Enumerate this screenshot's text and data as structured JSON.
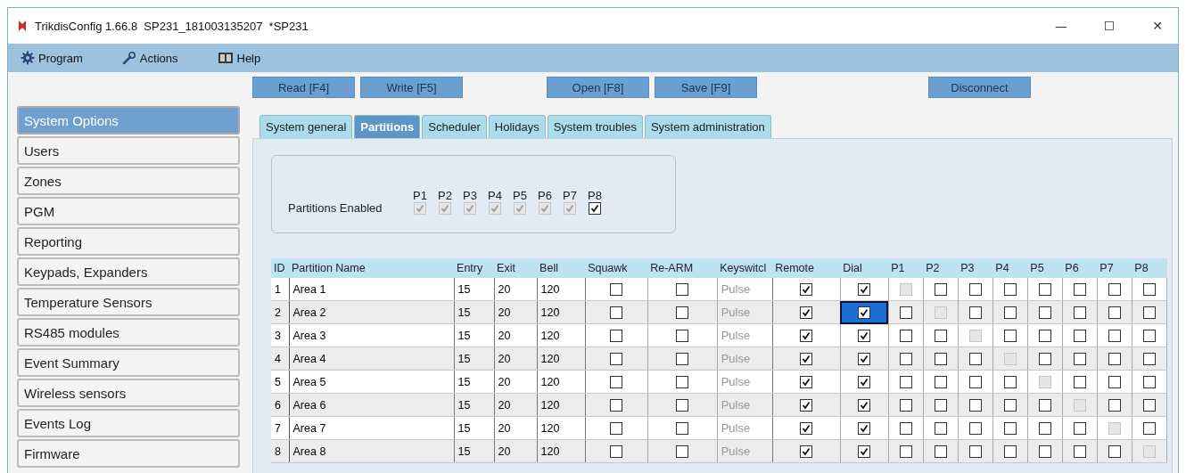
{
  "window": {
    "title": "TrikdisConfig 1.66.8  SP231_181003135207  *SP231",
    "controls": [
      "—",
      "☐",
      "✕"
    ]
  },
  "menu": [
    {
      "label": "Program"
    },
    {
      "label": "Actions"
    },
    {
      "label": "Help"
    }
  ],
  "toolbar": [
    {
      "label": "Read [F4]"
    },
    {
      "label": "Write [F5]"
    },
    {
      "label": "Open [F8]"
    },
    {
      "label": "Save [F9]"
    },
    {
      "label": "Disconnect"
    }
  ],
  "sidebar": {
    "items": [
      {
        "label": "System Options",
        "selected": true
      },
      {
        "label": "Users",
        "selected": false
      },
      {
        "label": "Zones",
        "selected": false
      },
      {
        "label": "PGM",
        "selected": false
      },
      {
        "label": "Reporting",
        "selected": false
      },
      {
        "label": "Keypads, Expanders",
        "selected": false
      },
      {
        "label": "Temperature Sensors",
        "selected": false
      },
      {
        "label": "RS485 modules",
        "selected": false
      },
      {
        "label": "Event Summary",
        "selected": false
      },
      {
        "label": "Wireless sensors",
        "selected": false
      },
      {
        "label": "Events Log",
        "selected": false
      },
      {
        "label": "Firmware",
        "selected": false
      }
    ]
  },
  "tabs": [
    {
      "label": "System general",
      "selected": false
    },
    {
      "label": "Partitions",
      "selected": true
    },
    {
      "label": "Scheduler",
      "selected": false
    },
    {
      "label": "Holidays",
      "selected": false
    },
    {
      "label": "System troubles",
      "selected": false
    },
    {
      "label": "System administration",
      "selected": false
    }
  ],
  "partitions_enabled": {
    "label": "Partitions Enabled",
    "items": [
      {
        "label": "P1",
        "checked": true,
        "disabled": true
      },
      {
        "label": "P2",
        "checked": true,
        "disabled": true
      },
      {
        "label": "P3",
        "checked": true,
        "disabled": true
      },
      {
        "label": "P4",
        "checked": true,
        "disabled": true
      },
      {
        "label": "P5",
        "checked": true,
        "disabled": true
      },
      {
        "label": "P6",
        "checked": true,
        "disabled": true
      },
      {
        "label": "P7",
        "checked": true,
        "disabled": true
      },
      {
        "label": "P8",
        "checked": true,
        "disabled": false
      }
    ]
  },
  "table": {
    "columns": [
      "ID",
      "Partition Name",
      "Entry",
      "Exit",
      "Bell",
      "Squawk",
      "Re-ARM",
      "Keyswitcl",
      "Remote",
      "Dial",
      "P1",
      "P2",
      "P3",
      "P4",
      "P5",
      "P6",
      "P7",
      "P8"
    ],
    "rows": [
      {
        "id": "1",
        "name": "Area 1",
        "entry": "15",
        "exit": "20",
        "bell": "120",
        "squawk": false,
        "rearm": false,
        "keyswitch": "Pulse",
        "remote": true,
        "dial": true,
        "dial_selected": false,
        "partitions": [
          {
            "checked": false,
            "disabled": true
          },
          {
            "checked": false,
            "disabled": false
          },
          {
            "checked": false,
            "disabled": false
          },
          {
            "checked": false,
            "disabled": false
          },
          {
            "checked": false,
            "disabled": false
          },
          {
            "checked": false,
            "disabled": false
          },
          {
            "checked": false,
            "disabled": false
          },
          {
            "checked": false,
            "disabled": false
          }
        ]
      },
      {
        "id": "2",
        "name": "Area 2",
        "entry": "15",
        "exit": "20",
        "bell": "120",
        "squawk": false,
        "rearm": false,
        "keyswitch": "Pulse",
        "remote": true,
        "dial": true,
        "dial_selected": true,
        "partitions": [
          {
            "checked": false,
            "disabled": false
          },
          {
            "checked": false,
            "disabled": true
          },
          {
            "checked": false,
            "disabled": false
          },
          {
            "checked": false,
            "disabled": false
          },
          {
            "checked": false,
            "disabled": false
          },
          {
            "checked": false,
            "disabled": false
          },
          {
            "checked": false,
            "disabled": false
          },
          {
            "checked": false,
            "disabled": false
          }
        ]
      },
      {
        "id": "3",
        "name": "Area 3",
        "entry": "15",
        "exit": "20",
        "bell": "120",
        "squawk": false,
        "rearm": false,
        "keyswitch": "Pulse",
        "remote": true,
        "dial": true,
        "dial_selected": false,
        "partitions": [
          {
            "checked": false,
            "disabled": false
          },
          {
            "checked": false,
            "disabled": false
          },
          {
            "checked": false,
            "disabled": true
          },
          {
            "checked": false,
            "disabled": false
          },
          {
            "checked": false,
            "disabled": false
          },
          {
            "checked": false,
            "disabled": false
          },
          {
            "checked": false,
            "disabled": false
          },
          {
            "checked": false,
            "disabled": false
          }
        ]
      },
      {
        "id": "4",
        "name": "Area 4",
        "entry": "15",
        "exit": "20",
        "bell": "120",
        "squawk": false,
        "rearm": false,
        "keyswitch": "Pulse",
        "remote": true,
        "dial": true,
        "dial_selected": false,
        "partitions": [
          {
            "checked": false,
            "disabled": false
          },
          {
            "checked": false,
            "disabled": false
          },
          {
            "checked": false,
            "disabled": false
          },
          {
            "checked": false,
            "disabled": true
          },
          {
            "checked": false,
            "disabled": false
          },
          {
            "checked": false,
            "disabled": false
          },
          {
            "checked": false,
            "disabled": false
          },
          {
            "checked": false,
            "disabled": false
          }
        ]
      },
      {
        "id": "5",
        "name": "Area 5",
        "entry": "15",
        "exit": "20",
        "bell": "120",
        "squawk": false,
        "rearm": false,
        "keyswitch": "Pulse",
        "remote": true,
        "dial": true,
        "dial_selected": false,
        "partitions": [
          {
            "checked": false,
            "disabled": false
          },
          {
            "checked": false,
            "disabled": false
          },
          {
            "checked": false,
            "disabled": false
          },
          {
            "checked": false,
            "disabled": false
          },
          {
            "checked": false,
            "disabled": true
          },
          {
            "checked": false,
            "disabled": false
          },
          {
            "checked": false,
            "disabled": false
          },
          {
            "checked": false,
            "disabled": false
          }
        ]
      },
      {
        "id": "6",
        "name": "Area 6",
        "entry": "15",
        "exit": "20",
        "bell": "120",
        "squawk": false,
        "rearm": false,
        "keyswitch": "Pulse",
        "remote": true,
        "dial": true,
        "dial_selected": false,
        "partitions": [
          {
            "checked": false,
            "disabled": false
          },
          {
            "checked": false,
            "disabled": false
          },
          {
            "checked": false,
            "disabled": false
          },
          {
            "checked": false,
            "disabled": false
          },
          {
            "checked": false,
            "disabled": false
          },
          {
            "checked": false,
            "disabled": true
          },
          {
            "checked": false,
            "disabled": false
          },
          {
            "checked": false,
            "disabled": false
          }
        ]
      },
      {
        "id": "7",
        "name": "Area 7",
        "entry": "15",
        "exit": "20",
        "bell": "120",
        "squawk": false,
        "rearm": false,
        "keyswitch": "Pulse",
        "remote": true,
        "dial": true,
        "dial_selected": false,
        "partitions": [
          {
            "checked": false,
            "disabled": false
          },
          {
            "checked": false,
            "disabled": false
          },
          {
            "checked": false,
            "disabled": false
          },
          {
            "checked": false,
            "disabled": false
          },
          {
            "checked": false,
            "disabled": false
          },
          {
            "checked": false,
            "disabled": false
          },
          {
            "checked": false,
            "disabled": true
          },
          {
            "checked": false,
            "disabled": false
          }
        ]
      },
      {
        "id": "8",
        "name": "Area 8",
        "entry": "15",
        "exit": "20",
        "bell": "120",
        "squawk": false,
        "rearm": false,
        "keyswitch": "Pulse",
        "remote": true,
        "dial": true,
        "dial_selected": false,
        "partitions": [
          {
            "checked": false,
            "disabled": false
          },
          {
            "checked": false,
            "disabled": false
          },
          {
            "checked": false,
            "disabled": false
          },
          {
            "checked": false,
            "disabled": false
          },
          {
            "checked": false,
            "disabled": false
          },
          {
            "checked": false,
            "disabled": false
          },
          {
            "checked": false,
            "disabled": false
          },
          {
            "checked": false,
            "disabled": true
          }
        ]
      }
    ]
  }
}
